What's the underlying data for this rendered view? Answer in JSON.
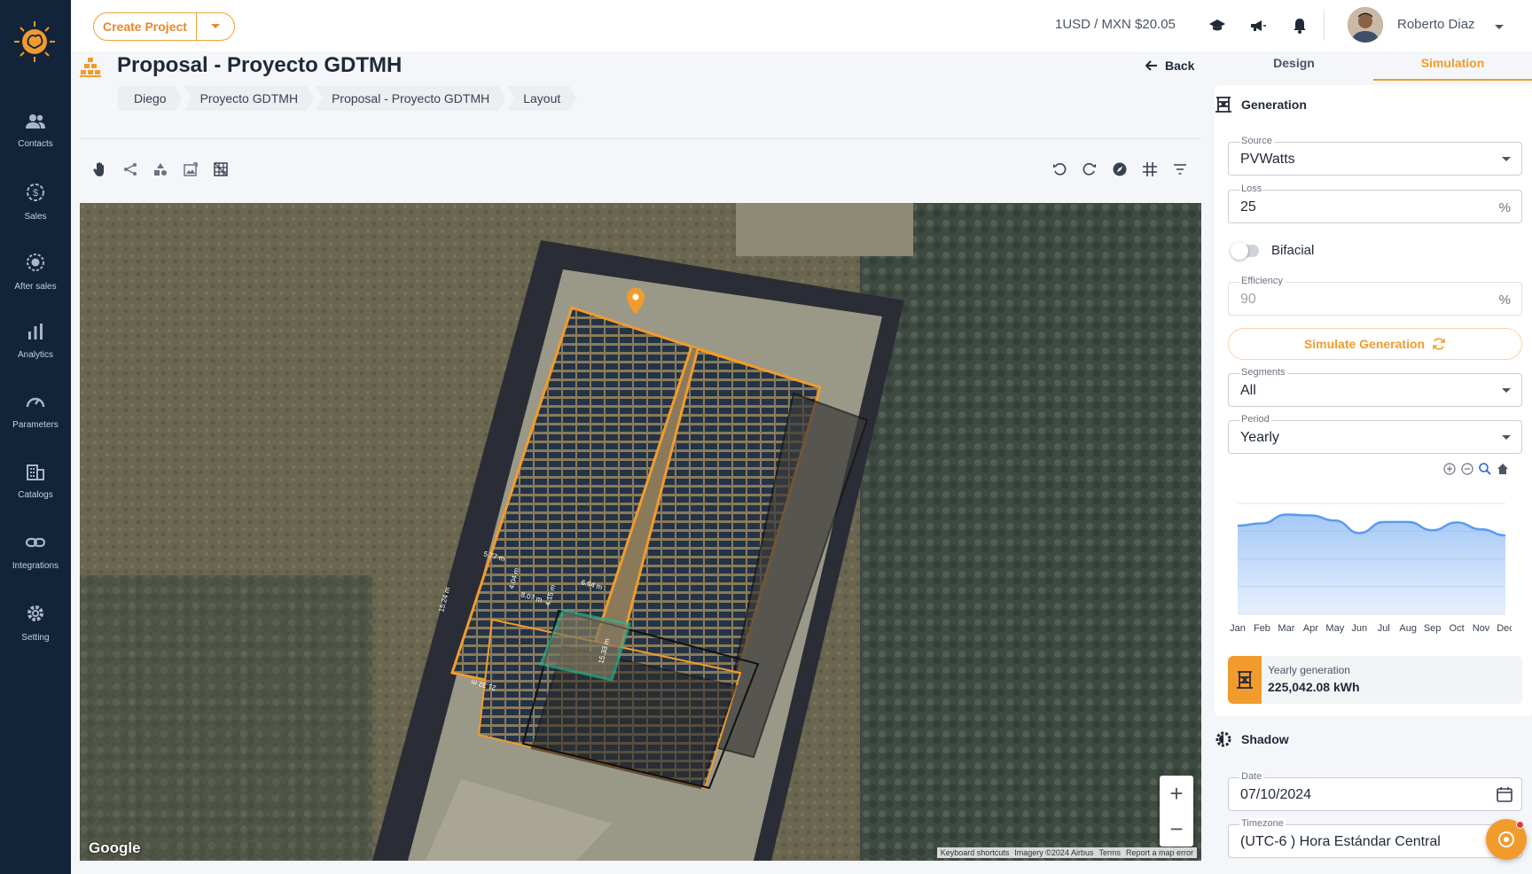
{
  "app": {
    "accent_color": "#f29b2d",
    "sidebar_bg": "#11243a",
    "logo_icon": "sun-brain-logo"
  },
  "sidebar": {
    "items": [
      {
        "label": "Contacts",
        "icon": "users-icon"
      },
      {
        "label": "Sales",
        "icon": "dollar-gear-icon"
      },
      {
        "label": "After sales",
        "icon": "badge-gear-icon"
      },
      {
        "label": "Analytics",
        "icon": "bar-chart-icon"
      },
      {
        "label": "Parameters",
        "icon": "gauge-icon"
      },
      {
        "label": "Catalogs",
        "icon": "building-icon"
      },
      {
        "label": "Integrations",
        "icon": "link-icon"
      },
      {
        "label": "Setting",
        "icon": "gear-icon"
      }
    ]
  },
  "topbar": {
    "create_label": "Create Project",
    "exchange_rate": "1USD / MXN $20.05",
    "user_name": "Roberto Diaz",
    "icons": [
      "graduation-cap-icon",
      "megaphone-icon",
      "bell-icon"
    ]
  },
  "header": {
    "title": "Proposal - Proyecto GDTMH",
    "back_label": "Back",
    "breadcrumbs": [
      "Diego",
      "Proyecto GDTMH",
      "Proposal - Proyecto GDTMH",
      "Layout"
    ]
  },
  "toolbar": {
    "left_icons": [
      "hand-pan-icon",
      "share-nodes-icon",
      "shapes-icon",
      "image-edit-icon",
      "grid-select-icon"
    ],
    "right_icons": [
      "rotate-left-icon",
      "rotate-right-icon",
      "compass-icon",
      "grid-lines-icon",
      "filter-icon"
    ]
  },
  "map": {
    "attribution_logo": "Google",
    "footer_links": [
      "Keyboard shortcuts",
      "Imagery ©2024 Airbus",
      "Terms",
      "Report a map error"
    ],
    "zoom_in": "+",
    "zoom_out": "−",
    "measurements": [
      "5.77 m",
      "6.94 m",
      "8.07 m",
      "4.04 m",
      "4.15 m",
      "15.24 m",
      "15.33 m",
      "21.32 m"
    ]
  },
  "panel": {
    "tabs": [
      {
        "label": "Design",
        "active": false
      },
      {
        "label": "Simulation",
        "active": true
      }
    ],
    "generation": {
      "heading": "Generation",
      "source": {
        "label": "Source",
        "value": "PVWatts"
      },
      "loss": {
        "label": "Loss",
        "value": "25",
        "suffix": "%"
      },
      "bifacial": {
        "label": "Bifacial",
        "enabled": false
      },
      "efficiency": {
        "label": "Efficiency",
        "value": "90",
        "suffix": "%"
      },
      "simulate_label": "Simulate Generation",
      "segments": {
        "label": "Segments",
        "value": "All"
      },
      "period": {
        "label": "Period",
        "value": "Yearly"
      },
      "yearly_label": "Yearly generation",
      "yearly_value": "225,042.08 kWh"
    },
    "shadow": {
      "heading": "Shadow",
      "date": {
        "label": "Date",
        "value": "07/10/2024"
      },
      "timezone": {
        "label": "Timezone",
        "value": "(UTC-6 ) Hora Estándar Central"
      }
    }
  },
  "chart_data": {
    "type": "area",
    "categories": [
      "Jan",
      "Feb",
      "Mar",
      "Apr",
      "May",
      "Jun",
      "Jul",
      "Aug",
      "Sep",
      "Oct",
      "Nov",
      "Dec"
    ],
    "values": [
      19200,
      19700,
      21600,
      21400,
      20300,
      17600,
      20000,
      20000,
      18200,
      19900,
      18400,
      17100
    ],
    "ylim": [
      0,
      24000
    ],
    "grid": true,
    "color": "#5b9bf0"
  }
}
